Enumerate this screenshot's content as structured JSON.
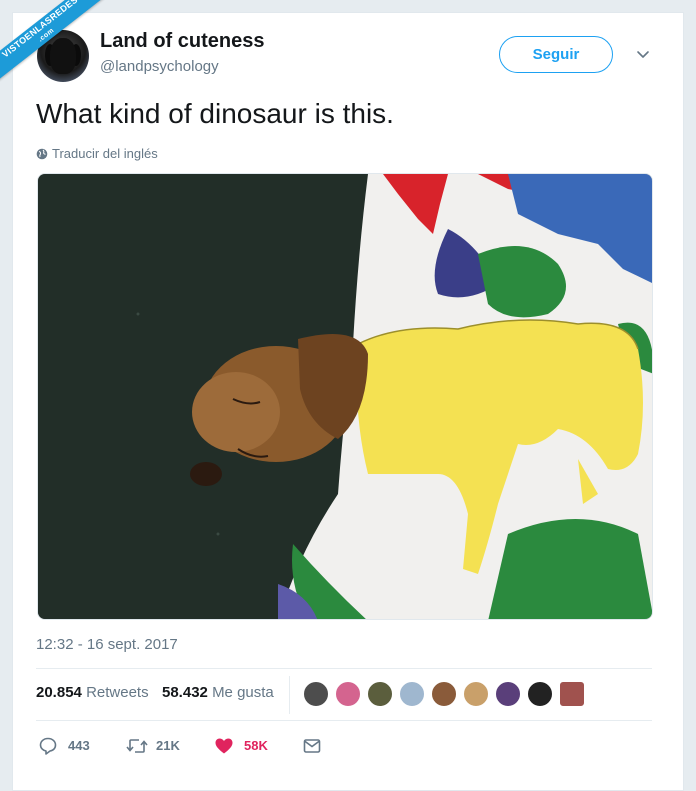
{
  "watermark": {
    "main": "VISTOENLASREDES",
    "sub": ".com"
  },
  "author": {
    "name": "Land of cuteness",
    "handle": "@landpsychology"
  },
  "follow_label": "Seguir",
  "tweet_text": "What kind of dinosaur is this.",
  "translate_label": "Traducir del inglés",
  "timestamp": "12:32 - 16 sept. 2017",
  "stats": {
    "retweets_count": "20.854",
    "retweets_label": "Retweets",
    "likes_count": "58.432",
    "likes_label": "Me gusta"
  },
  "actions": {
    "replies": "443",
    "retweets": "21K",
    "likes": "58K"
  },
  "colors": {
    "accent": "#1da1f2",
    "like": "#e0245e",
    "muted": "#657786",
    "text": "#14171a"
  },
  "icons": [
    "globe-icon",
    "chevron-down-icon",
    "reply-icon",
    "retweet-icon",
    "heart-icon",
    "mail-icon"
  ]
}
